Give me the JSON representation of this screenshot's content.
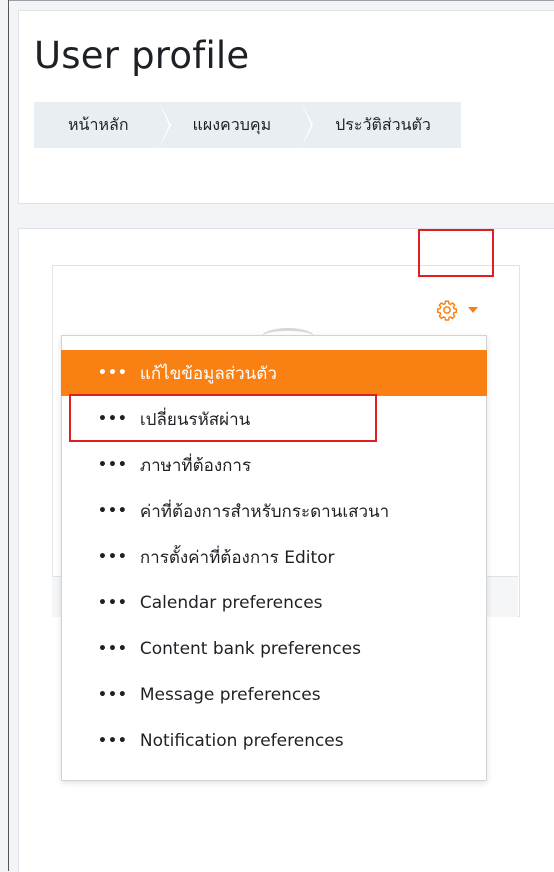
{
  "header": {
    "title": "User profile",
    "breadcrumb": [
      {
        "label": "หน้าหลัก"
      },
      {
        "label": "แผงควบคุม"
      },
      {
        "label": "ประวัติส่วนตัว"
      }
    ]
  },
  "actions_menu": {
    "toggle_icon": "gear-icon",
    "caret_icon": "caret-down-icon",
    "accent_color": "#f98012",
    "items": [
      {
        "label": "แก้ไขข้อมูลส่วนตัว",
        "active": true
      },
      {
        "label": "เปลี่ยนรหัสผ่าน",
        "active": false
      },
      {
        "label": "ภาษาที่ต้องการ",
        "active": false
      },
      {
        "label": "ค่าที่ต้องการสำหรับกระดานเสวนา",
        "active": false
      },
      {
        "label": "การตั้งค่าที่ต้องการ Editor",
        "active": false
      },
      {
        "label": "Calendar preferences",
        "active": false
      },
      {
        "label": "Content bank preferences",
        "active": false
      },
      {
        "label": "Message preferences",
        "active": false
      },
      {
        "label": "Notification preferences",
        "active": false
      }
    ]
  },
  "annotations": {
    "highlight_color": "#e02020"
  }
}
